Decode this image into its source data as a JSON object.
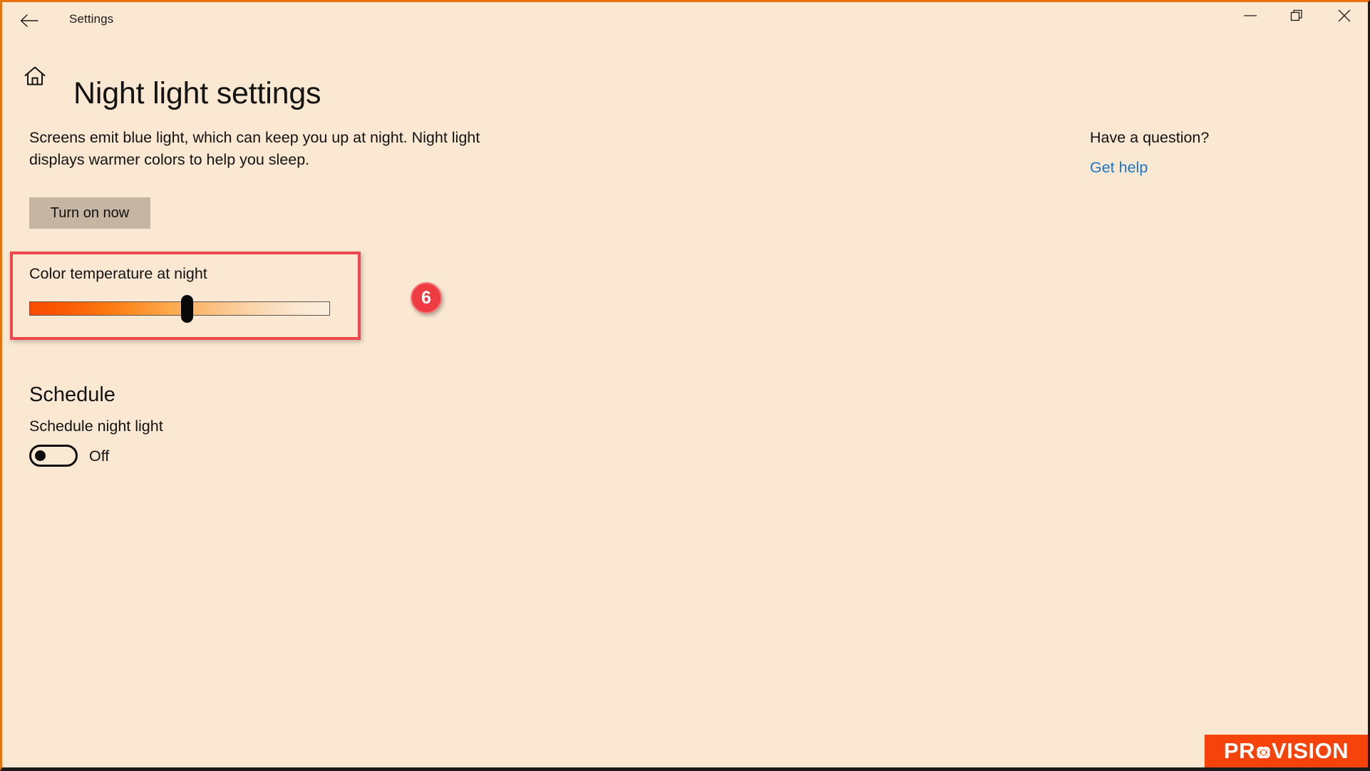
{
  "window": {
    "app_title": "Settings",
    "controls": {
      "back": "back-arrow",
      "minimize": "—",
      "maximize": "restore",
      "close": "×"
    }
  },
  "page": {
    "home_icon": "home-icon",
    "title": "Night light settings",
    "description": "Screens emit blue light, which can keep you up at night. Night light displays warmer colors to help you sleep.",
    "turn_on_label": "Turn on now"
  },
  "color_temperature": {
    "label": "Color temperature at night",
    "slider_value_percent": 50,
    "gradient_start": "#fa4b00",
    "gradient_end": "#fbeedd",
    "thumb_color": "#080808"
  },
  "annotation": {
    "step_number": "6",
    "badge_color": "#ef3b42",
    "highlight_color": "#f0464d"
  },
  "schedule": {
    "heading": "Schedule",
    "sublabel": "Schedule night light",
    "toggle_state": "Off",
    "toggle_on": false
  },
  "help": {
    "heading": "Have a question?",
    "link_label": "Get help",
    "link_color": "#1a76c8"
  },
  "watermark": {
    "text_before": "PR",
    "text_after": "VISION",
    "background": "#f5430b"
  }
}
